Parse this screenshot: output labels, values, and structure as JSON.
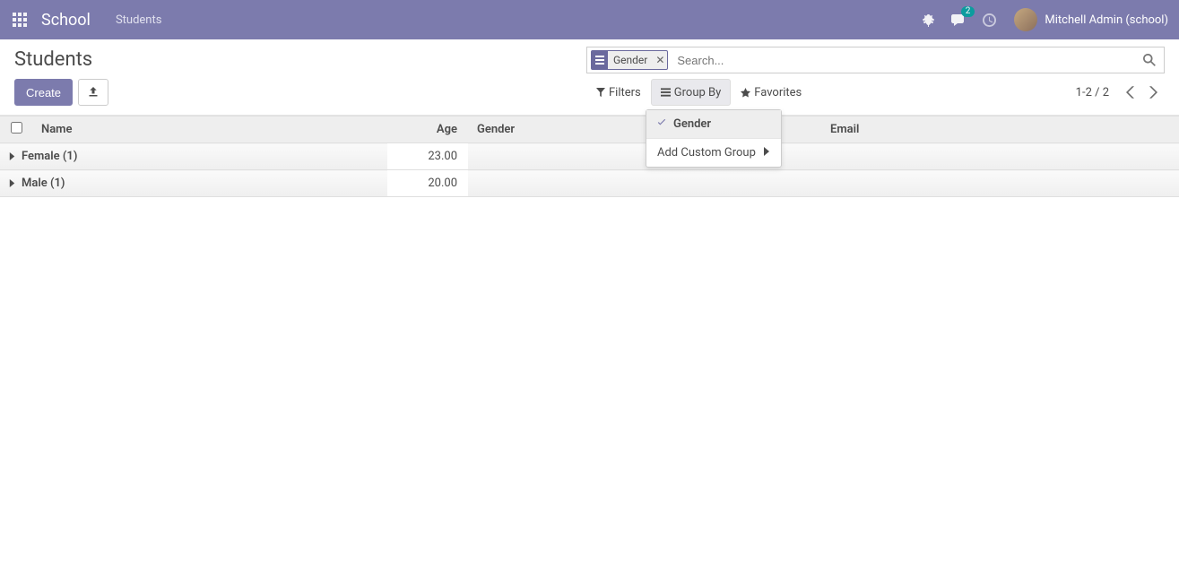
{
  "navbar": {
    "brand": "School",
    "menu_item": "Students",
    "chat_badge": "2",
    "username": "Mitchell Admin (school)"
  },
  "control_panel": {
    "title": "Students",
    "create_label": "Create",
    "search": {
      "facet_label": "Gender",
      "placeholder": "Search..."
    },
    "filters_label": "Filters",
    "groupby_label": "Group By",
    "favorites_label": "Favorites",
    "pager": "1-2 / 2"
  },
  "groupby_dropdown": {
    "items": [
      {
        "label": "Gender",
        "checked": true
      }
    ],
    "add_custom": "Add Custom Group"
  },
  "table": {
    "columns": {
      "name": "Name",
      "age": "Age",
      "gender": "Gender",
      "email": "Email"
    },
    "groups": [
      {
        "label": "Female (1)",
        "age": "23.00"
      },
      {
        "label": "Male (1)",
        "age": "20.00"
      }
    ]
  }
}
